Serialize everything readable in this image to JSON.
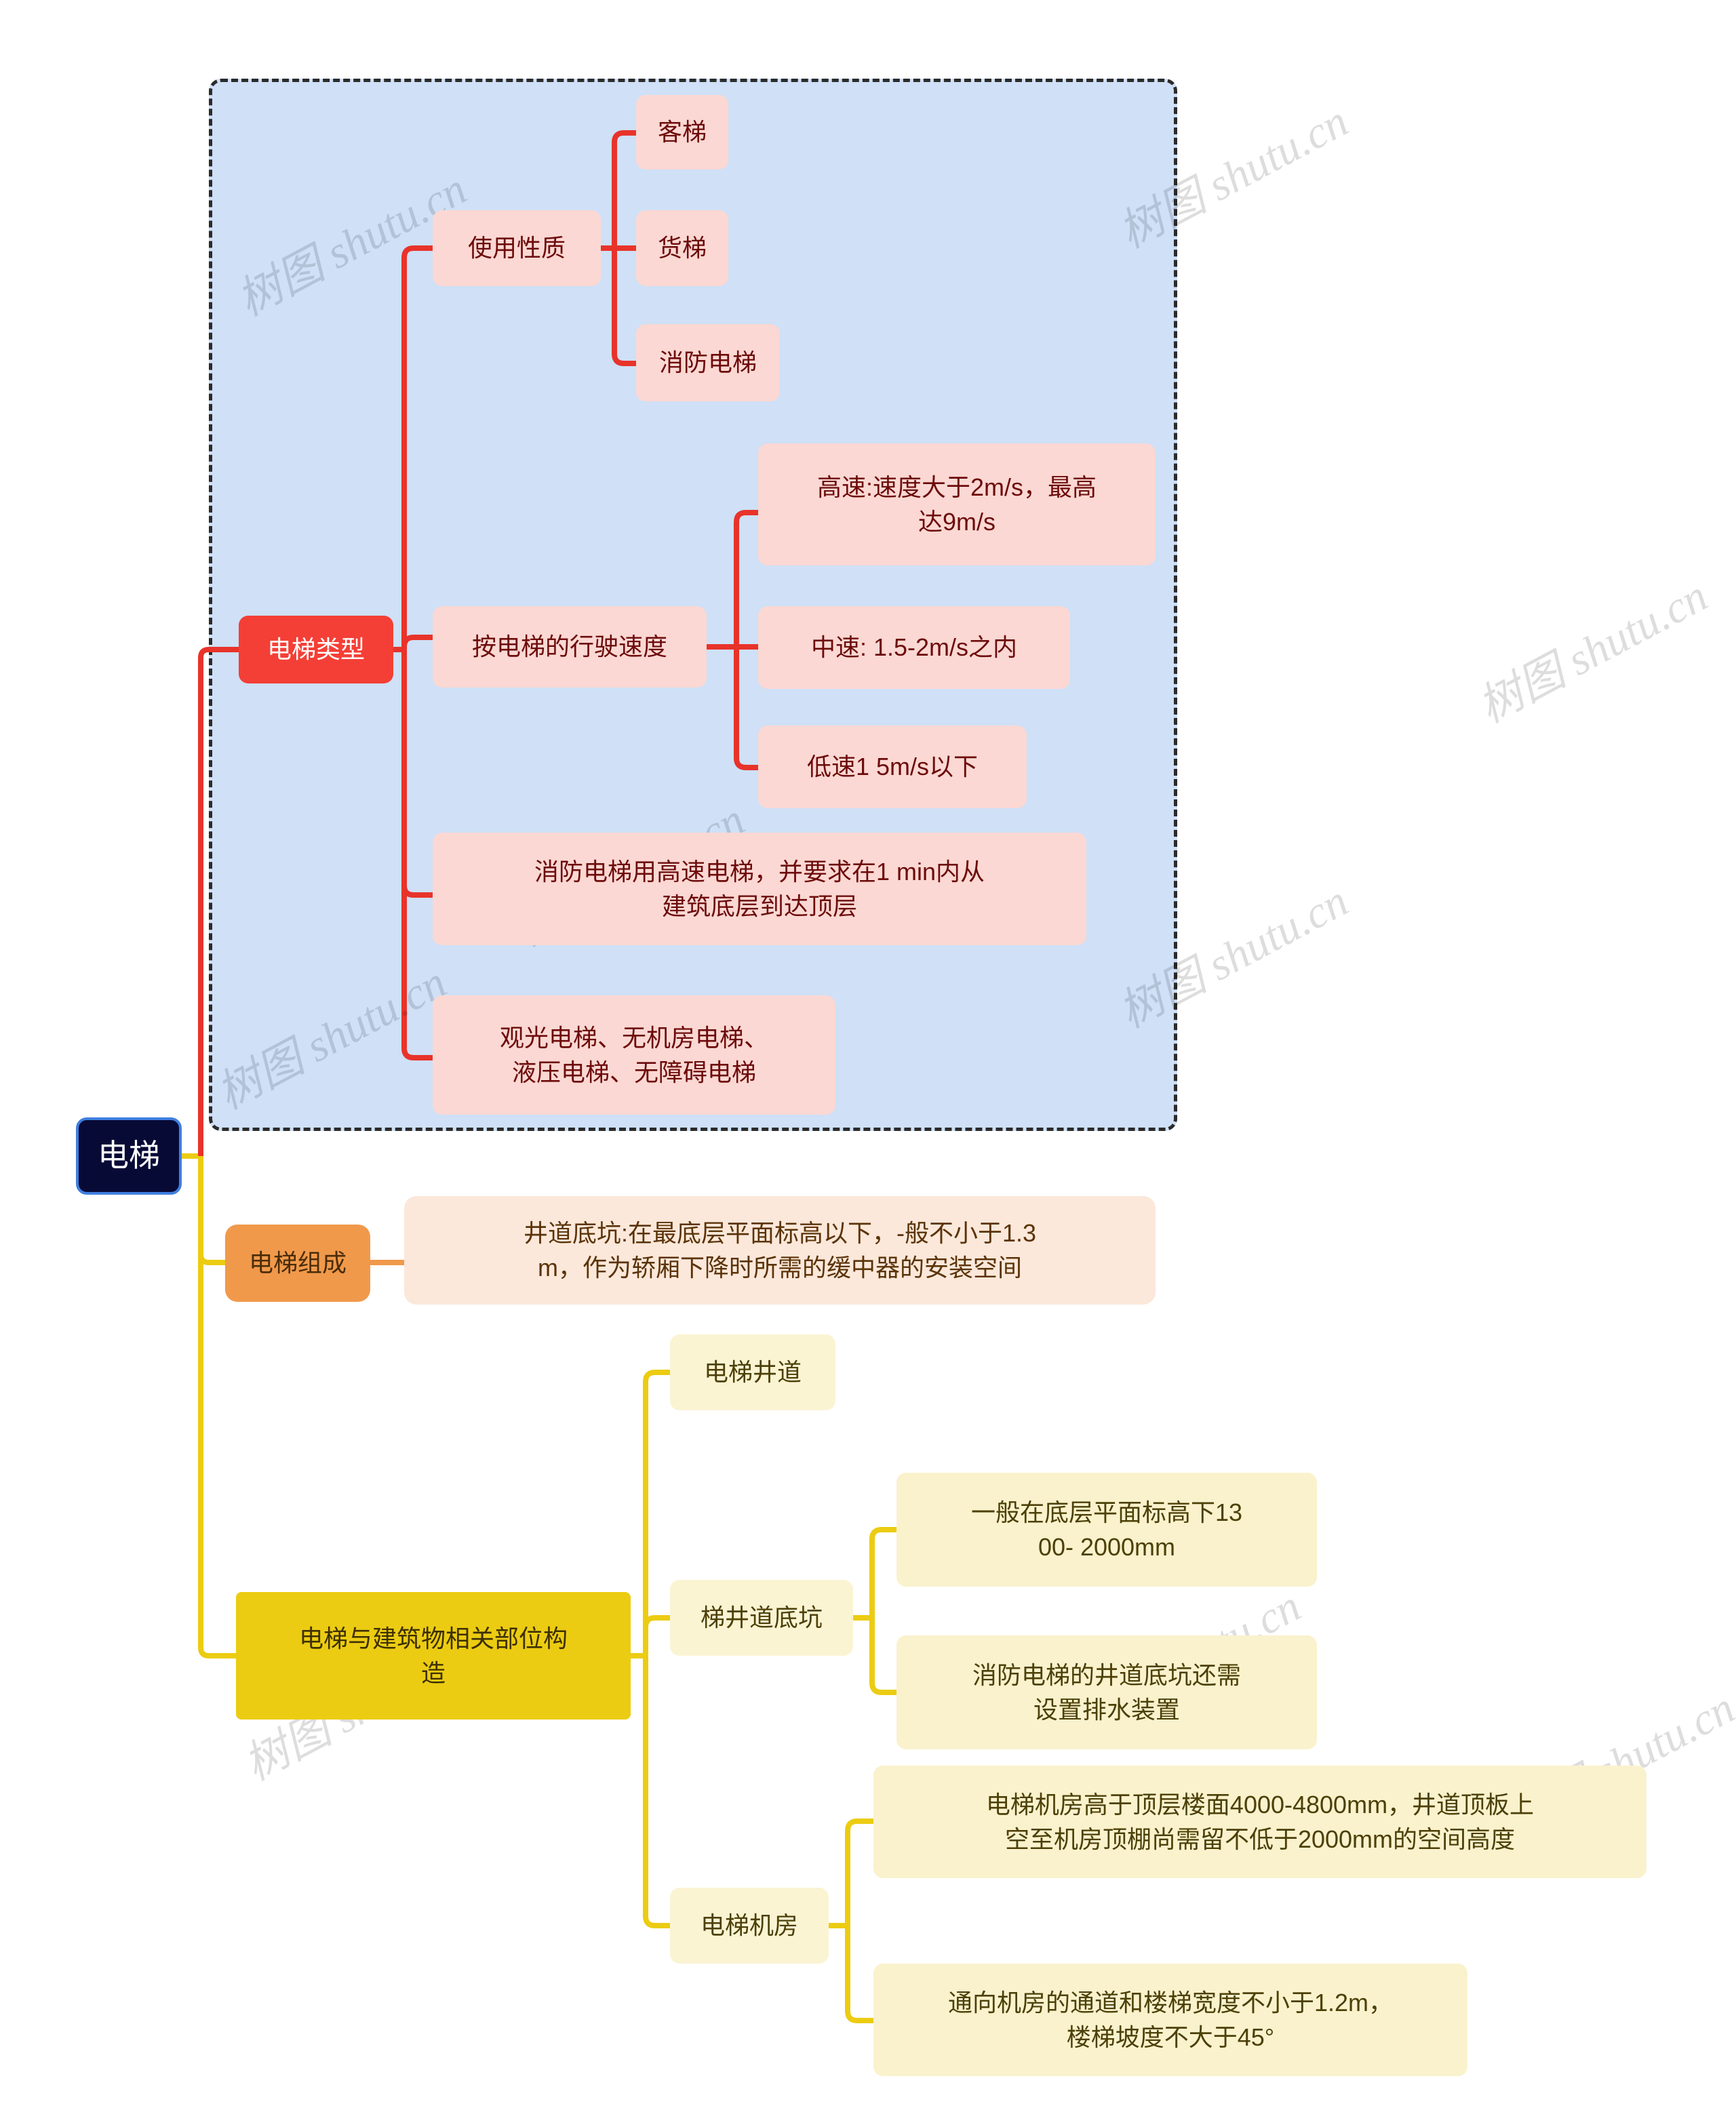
{
  "map": {
    "title": "电梯",
    "watermark_text": "树图 shutu.cn"
  },
  "root": {
    "label": "电梯"
  },
  "branches": [
    {
      "id": "elevator-type",
      "label": "电梯类型",
      "color": "#f43f36",
      "children": [
        {
          "id": "use-nature",
          "label": "使用性质",
          "children": [
            {
              "id": "passenger",
              "label": "客梯"
            },
            {
              "id": "freight",
              "label": "货梯"
            },
            {
              "id": "fire",
              "label": "消防电梯"
            }
          ]
        },
        {
          "id": "by-speed",
          "label": "按电梯的行驶速度",
          "children": [
            {
              "id": "high-speed",
              "label": "高速:速度大于2m/s，最高\n达9m/s"
            },
            {
              "id": "mid-speed",
              "label": "中速: 1.5-2m/s之内"
            },
            {
              "id": "low-speed",
              "label": "低速1 5m/s以下"
            }
          ]
        },
        {
          "id": "fire-note",
          "label": "消防电梯用高速电梯，并要求在1 min内从\n建筑底层到达顶层",
          "children": []
        },
        {
          "id": "other-types",
          "label": "观光电梯、无机房电梯、\n液压电梯、无障碍电梯",
          "children": []
        }
      ]
    },
    {
      "id": "elevator-composition",
      "label": "电梯组成",
      "color": "#f0994b",
      "children": [
        {
          "id": "shaft-pit",
          "label": "井道底坑:在最底层平面标高以下，-般不小于1.3\nm，作为轿厢下降时所需的缓中器的安装空间",
          "children": []
        }
      ]
    },
    {
      "id": "building-relation",
      "label": "电梯与建筑物相关部位构\n造",
      "color": "#eccc12",
      "children": [
        {
          "id": "elevator-shaft",
          "label": "电梯井道",
          "children": []
        },
        {
          "id": "shaft-bottom-pit",
          "label": "梯井道底坑",
          "children": [
            {
              "id": "pit-depth",
              "label": "一般在底层平面标高下13\n00- 2000mm"
            },
            {
              "id": "pit-drain",
              "label": "消防电梯的井道底坑还需\n设置排水装置"
            }
          ]
        },
        {
          "id": "machine-room",
          "label": "电梯机房",
          "children": [
            {
              "id": "mr-height",
              "label": "电梯机房高于顶层楼面4000-4800mm，井道顶板上\n空至机房顶棚尚需留不低于2000mm的空间高度"
            },
            {
              "id": "mr-access",
              "label": "通向机房的通道和楼梯宽度不小于1.2m，\n楼梯坡度不大于45°"
            }
          ]
        }
      ]
    }
  ],
  "colors": {
    "root_bg": "#080a36",
    "root_border": "#3f7fdf",
    "red_branch": "#f43f36",
    "red_leaf": "#fbd8d3",
    "orange_branch": "#f0994b",
    "orange_leaf": "#fbe8da",
    "yellow_branch": "#eccc12",
    "yellow_leaf": "#fbf4d3",
    "summary_bg": "#cfe0f7",
    "summary_border": "#2b2b2b"
  }
}
